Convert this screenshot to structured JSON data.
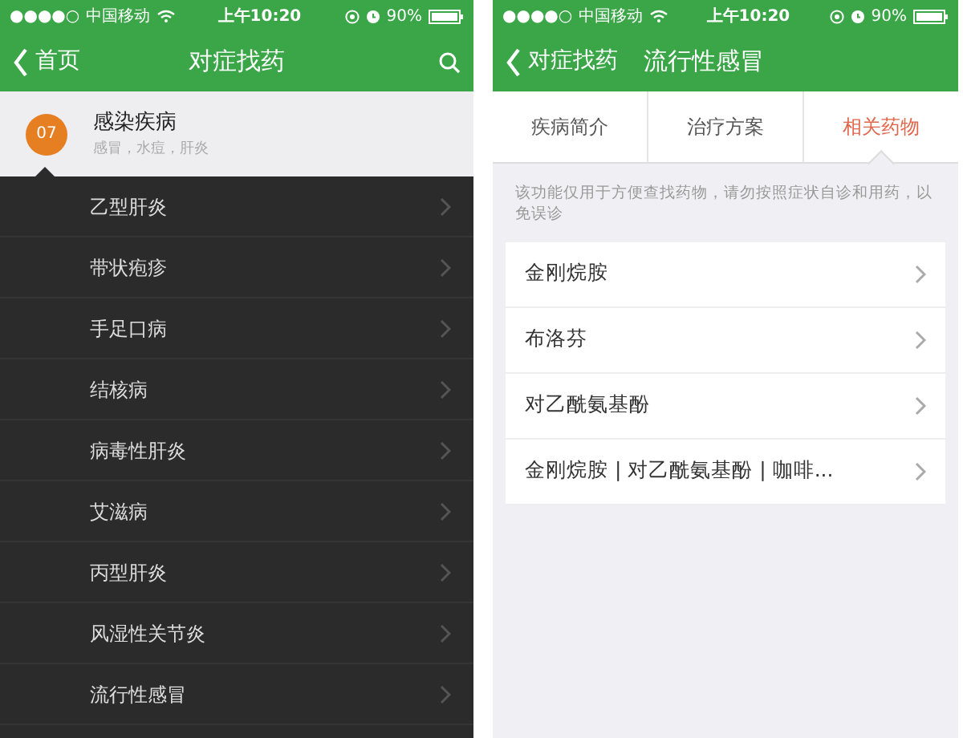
{
  "left_screen": {
    "status_bar": {
      "signal": "●●●●○",
      "carrier": "中国移动",
      "time": "上午10:20",
      "battery": "90%"
    },
    "nav": {
      "back": "首页",
      "title": "对症找药"
    },
    "category": {
      "badge": "07",
      "title": "感染疾病",
      "subtitle": "感冒，水痘，肝炎",
      "expanded": true
    },
    "diseases": [
      "乙型肝炎",
      "带状疱疹",
      "手足口病",
      "结核病",
      "病毒性肝炎",
      "艾滋病",
      "丙型肝炎",
      "风湿性关节炎",
      "流行性感冒"
    ]
  },
  "right_screen": {
    "status_bar": {
      "signal": "●●●●○",
      "carrier": "中国移动",
      "time": "上午10:20",
      "battery": "90%"
    },
    "nav": {
      "back": "对症找药",
      "title": "流行性感冒"
    },
    "tabs": [
      {
        "label": "疾病简介",
        "selected": false
      },
      {
        "label": "治疗方案",
        "selected": false
      },
      {
        "label": "相关药物",
        "selected": true
      }
    ],
    "notice": "该功能仅用于方便查找药物，请勿按照症状自诊和用药，以免误诊",
    "drugs": [
      "金刚烷胺",
      "布洛芬",
      "对乙酰氨基酚",
      "金刚烷胺 | 对乙酰氨基酚 | 咖啡..."
    ]
  }
}
